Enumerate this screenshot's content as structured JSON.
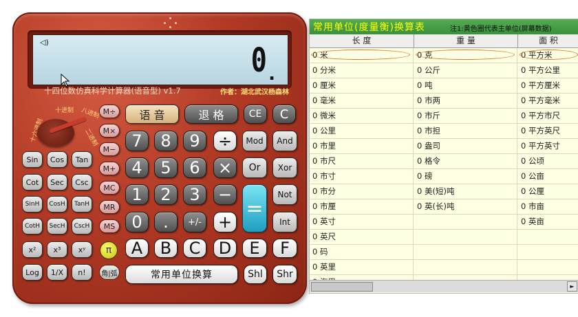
{
  "calculator": {
    "display": {
      "value": "0",
      "dot": "."
    },
    "title": "十四位数仿真科学计算器(语音型) v1.7",
    "author": "作者：湖北武汉杨森林",
    "knob_labels": [
      "十进制",
      "八进制",
      "十六进制",
      "二进制"
    ],
    "buttons": {
      "voice": "语 音",
      "backspace": "退 格",
      "ce": "CE",
      "c": "C",
      "mem": [
        "M÷",
        "M×",
        "M−",
        "M+",
        "MC",
        "MR",
        "MS"
      ],
      "trig": [
        [
          "Sin",
          "Cos",
          "Tan"
        ],
        [
          "Cot",
          "Sec",
          "Csc"
        ],
        [
          "SinH",
          "CosH",
          "TanH"
        ],
        [
          "CotH",
          "SecH",
          "CscH"
        ]
      ],
      "power": [
        "x²",
        "x³",
        "xʸ"
      ],
      "misc": [
        "Log",
        "1/X",
        "n!"
      ],
      "digits": [
        "7",
        "8",
        "9",
        "4",
        "5",
        "6",
        "1",
        "2",
        "3",
        "0",
        "."
      ],
      "sign": "+/-",
      "ops": {
        "div": "÷",
        "mul": "×",
        "sub": "−",
        "add": "+",
        "eq": "="
      },
      "logic": [
        "Mod",
        "And",
        "Or",
        "Xor",
        "Not",
        "Int"
      ],
      "hex": [
        "A",
        "B",
        "C",
        "D",
        "E",
        "F"
      ],
      "pi": "π",
      "angle": "角|弧",
      "unit_convert": "常用单位换算",
      "shl": "Shl",
      "shr": "Shr"
    }
  },
  "table": {
    "title": "常用单位(度量衡)换算表",
    "note": "注1:黄色圈代表主单位(屏幕数据)",
    "columns": [
      "长 度",
      "重 量",
      "面 积"
    ],
    "length": [
      "0 米",
      "0 分米",
      "0 厘米",
      "0 毫米",
      "0 微米",
      "0 公里",
      "0 市里",
      "0 市尺",
      "0 市寸",
      "0 市分",
      "0 市厘",
      "0 英寸",
      "0 英尺",
      "0 码",
      "0 英里",
      "0 海里"
    ],
    "weight": [
      "0 克",
      "0 公斤",
      "0 吨",
      "0 市两",
      "0 市斤",
      "0 市担",
      "0 盎司",
      "0 格令",
      "0 磅",
      "0 美(短)吨",
      "0 英(长)吨",
      "",
      "",
      "",
      "",
      ""
    ],
    "area": [
      "0 平方米",
      "0 平方公里",
      "0 平方厘米",
      "0 平方毫米",
      "0 平方市尺",
      "0 平方英尺",
      "0 平方英寸",
      "0 公顷",
      "0 公亩",
      "0 公厘",
      "0 市亩",
      "0 英亩",
      "",
      "",
      "",
      ""
    ],
    "scroll_arrow": "►"
  }
}
